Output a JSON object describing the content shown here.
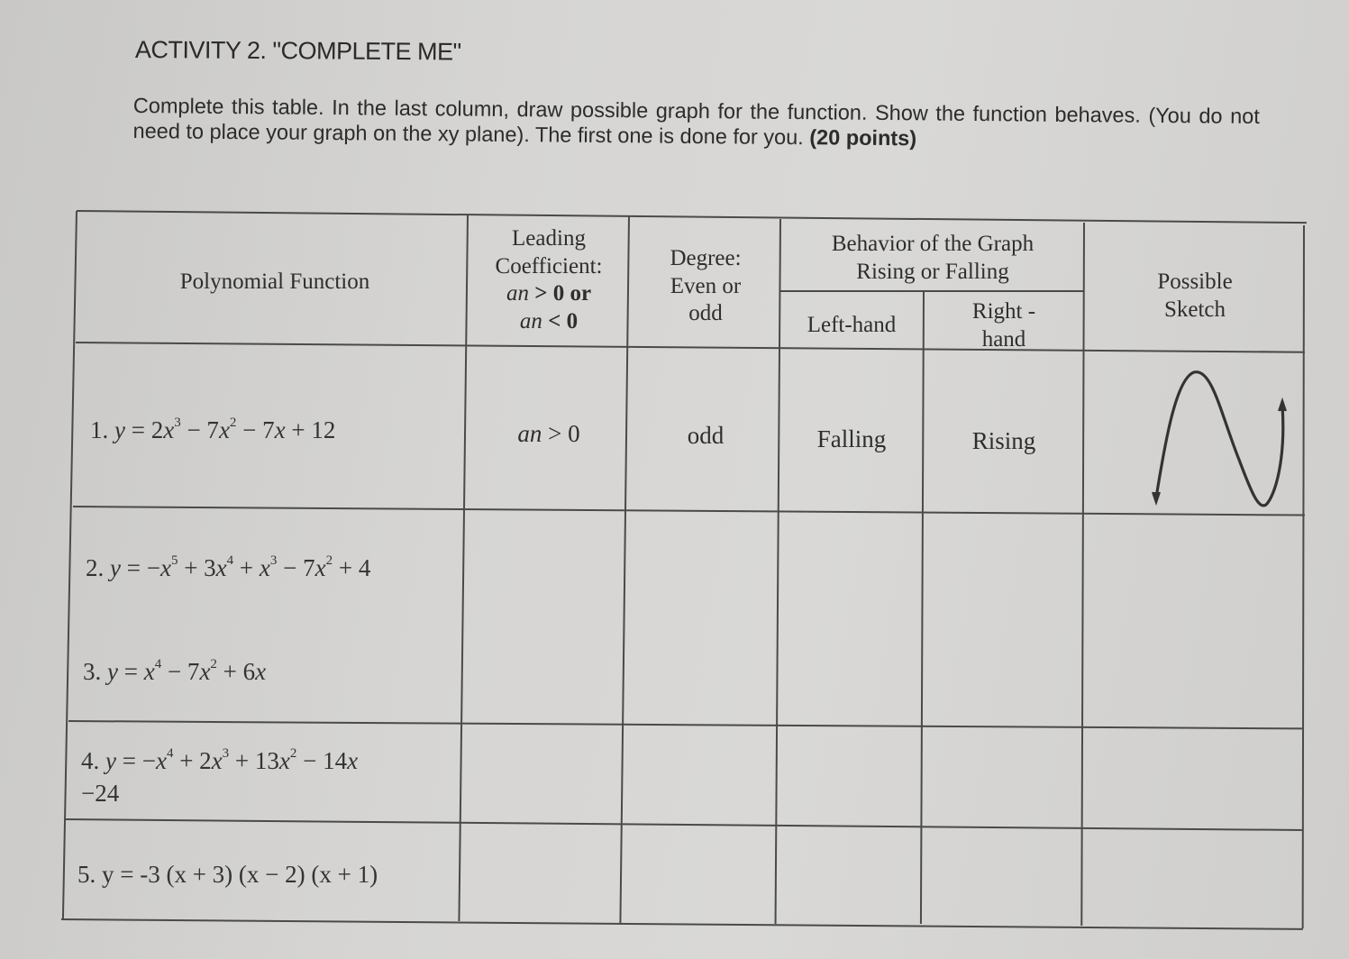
{
  "document": {
    "title": "ACTIVITY 2. \"COMPLETE ME\"",
    "instructions": "Complete this table. In the last column, draw possible graph for the function. Show the function behaves. (You do not need to place your graph on the xy plane). The first one is done for you.",
    "points": "(20 points)"
  },
  "table": {
    "headers": {
      "polynomial_function": "Polynomial Function",
      "leading_coefficient_line1": "Leading",
      "leading_coefficient_line2": "Coefficient:",
      "leading_coefficient_opt1": "an > 0 or",
      "leading_coefficient_opt2": "an < 0",
      "degree_line1": "Degree:",
      "degree_line2": "Even or",
      "degree_line3": "odd",
      "behavior_line1": "Behavior of the Graph",
      "behavior_line2": "Rising or Falling",
      "left_hand": "Left-hand",
      "right_hand_line1": "Right -",
      "right_hand_line2": "hand",
      "sketch_line1": "Possible",
      "sketch_line2": "Sketch"
    },
    "rows": [
      {
        "number": "1.",
        "function": "y = 2x³ − 7x² − 7x + 12",
        "leading_coefficient": "an > 0",
        "degree": "odd",
        "left_hand": "Falling",
        "right_hand": "Rising",
        "sketch": "cubic-curve-sketch"
      },
      {
        "number": "2.",
        "function": "y = −x⁵ + 3x⁴ + x³ − 7x² + 4",
        "leading_coefficient": "",
        "degree": "",
        "left_hand": "",
        "right_hand": "",
        "sketch": ""
      },
      {
        "number": "3.",
        "function": "y = x⁴ − 7x² + 6x",
        "leading_coefficient": "",
        "degree": "",
        "left_hand": "",
        "right_hand": "",
        "sketch": ""
      },
      {
        "number": "4.",
        "function": "y = −x⁴ + 2x³ + 13x² − 14x −24",
        "leading_coefficient": "",
        "degree": "",
        "left_hand": "",
        "right_hand": "",
        "sketch": ""
      },
      {
        "number": "5.",
        "function": "y = -3 (x + 3) (x − 2) (x + 1)",
        "leading_coefficient": "",
        "degree": "",
        "left_hand": "",
        "right_hand": "",
        "sketch": ""
      }
    ]
  },
  "func_parts": {
    "r1": {
      "n": "1.",
      "a": "y",
      "b": " = 2",
      "c": "x",
      "d": "3",
      "e": " − 7",
      "f": "x",
      "g": "2",
      "h": " − 7",
      "i": "x",
      "j": " + 12"
    },
    "r2": {
      "n": "2.",
      "a": "y",
      "b": " = −",
      "c": "x",
      "d": "5",
      "e": " + 3",
      "f": "x",
      "g": "4",
      "h": " + ",
      "i": "x",
      "j": "3",
      "k": " − 7",
      "l": "x",
      "m": "2",
      "o": " + 4"
    },
    "r3": {
      "n": "3.",
      "a": "y",
      "b": " = ",
      "c": "x",
      "d": "4",
      "e": " − 7",
      "f": "x",
      "g": "2",
      "h": " + 6",
      "i": "x"
    },
    "r4": {
      "n": "4.",
      "a": "y",
      "b": " = −",
      "c": "x",
      "d": "4",
      "e": " + 2",
      "f": "x",
      "g": "3",
      "h": " + 13",
      "i": "x",
      "j": "2",
      "k": " − 14",
      "l": "x",
      "m": "−24"
    },
    "r5": {
      "n": "5.",
      "a": "y",
      "b": " =  -3 (x + 3) (x − 2) (x + 1)"
    }
  },
  "lc_parts": {
    "an": "an",
    "gt0or": " > 0 or",
    "lt0": " < 0",
    "gt0": " > 0"
  }
}
